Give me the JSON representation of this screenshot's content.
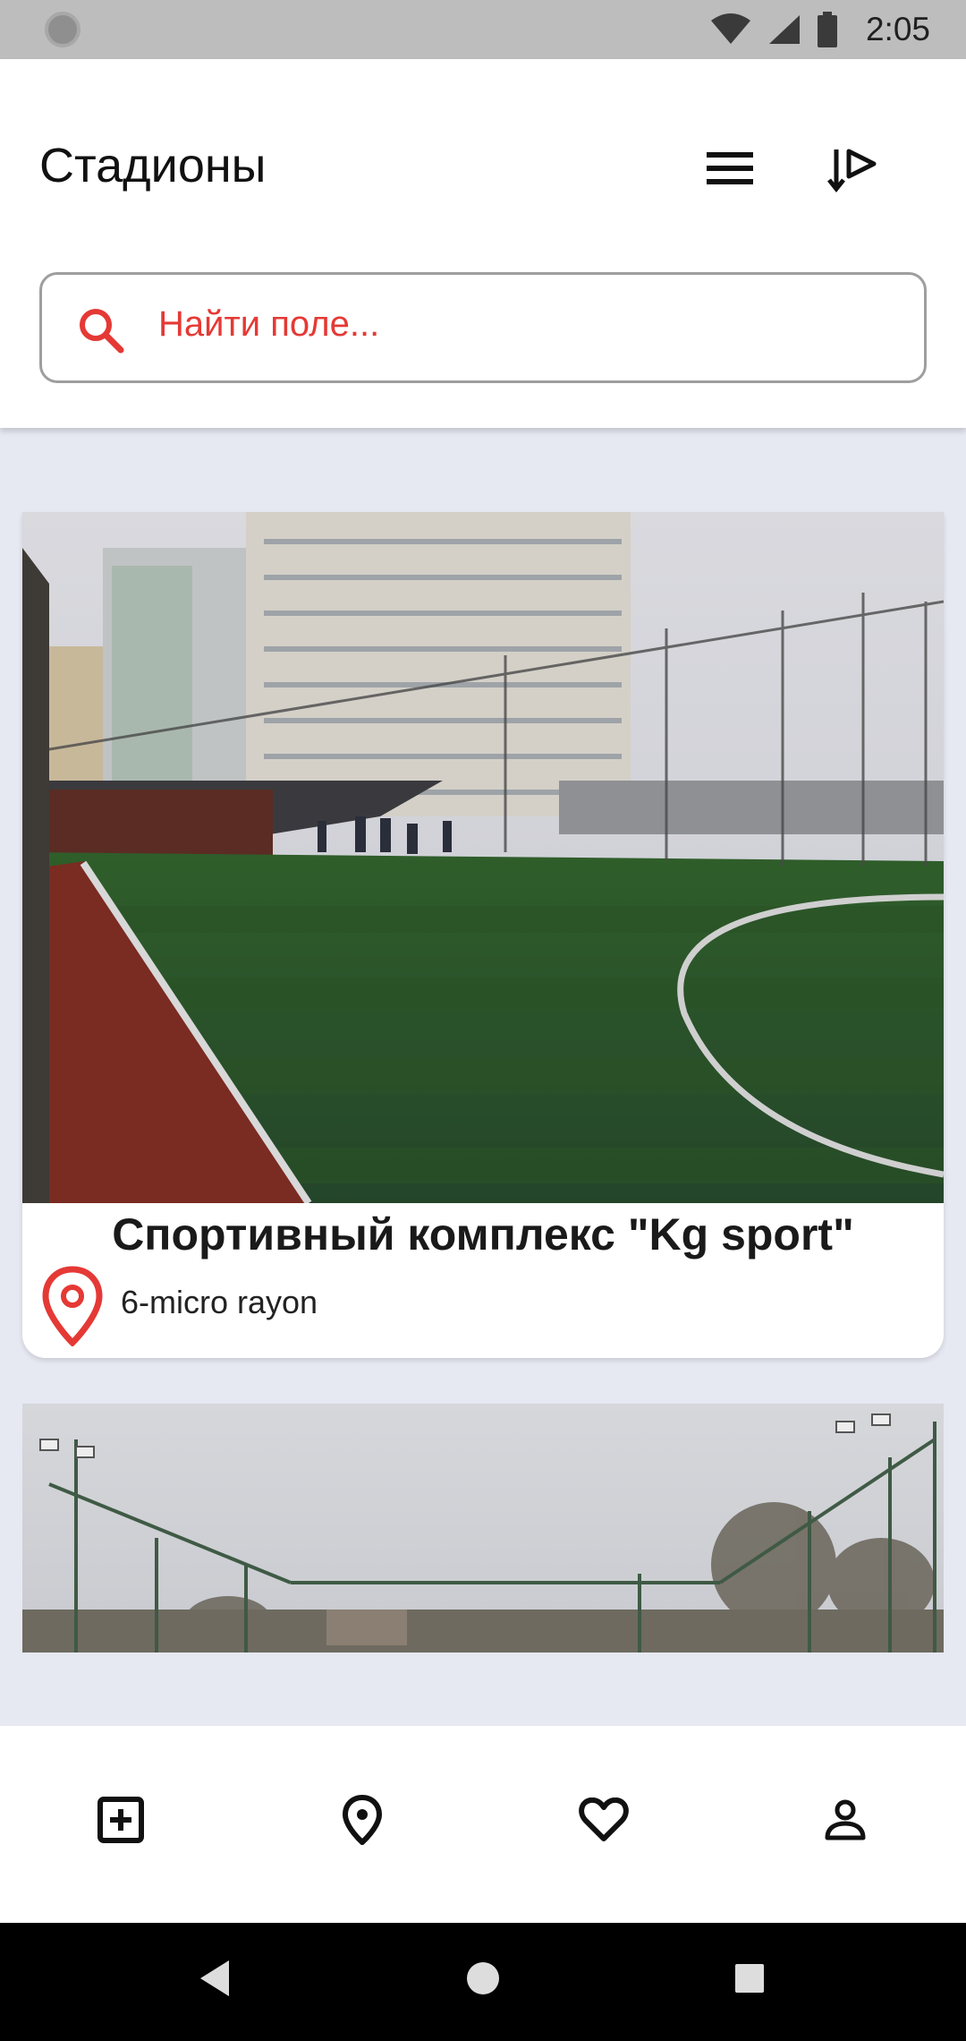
{
  "status_bar": {
    "time": "2:05",
    "icons": [
      "notification-dot-icon",
      "wifi-icon",
      "cellular-signal-icon",
      "battery-icon"
    ]
  },
  "header": {
    "title": "Стадионы",
    "menu_icon": "menu-icon",
    "sort_icon": "sort-icon"
  },
  "search": {
    "placeholder": "Найти поле...",
    "icon": "search-icon"
  },
  "stadiums": [
    {
      "name": "Спортивный комплекс \"Kg sport\"",
      "address": "6-micro rayon",
      "location_icon": "location-pin-icon"
    }
  ],
  "bottom_nav": {
    "items": [
      "add-box-icon",
      "location-pin-icon",
      "heart-icon",
      "person-icon"
    ]
  },
  "system_nav": {
    "items": [
      "back-icon",
      "home-icon",
      "recents-icon"
    ]
  },
  "colors": {
    "accent": "#E53935",
    "list_background": "#E6E8F2",
    "status_bar": "#BDBDBD"
  }
}
